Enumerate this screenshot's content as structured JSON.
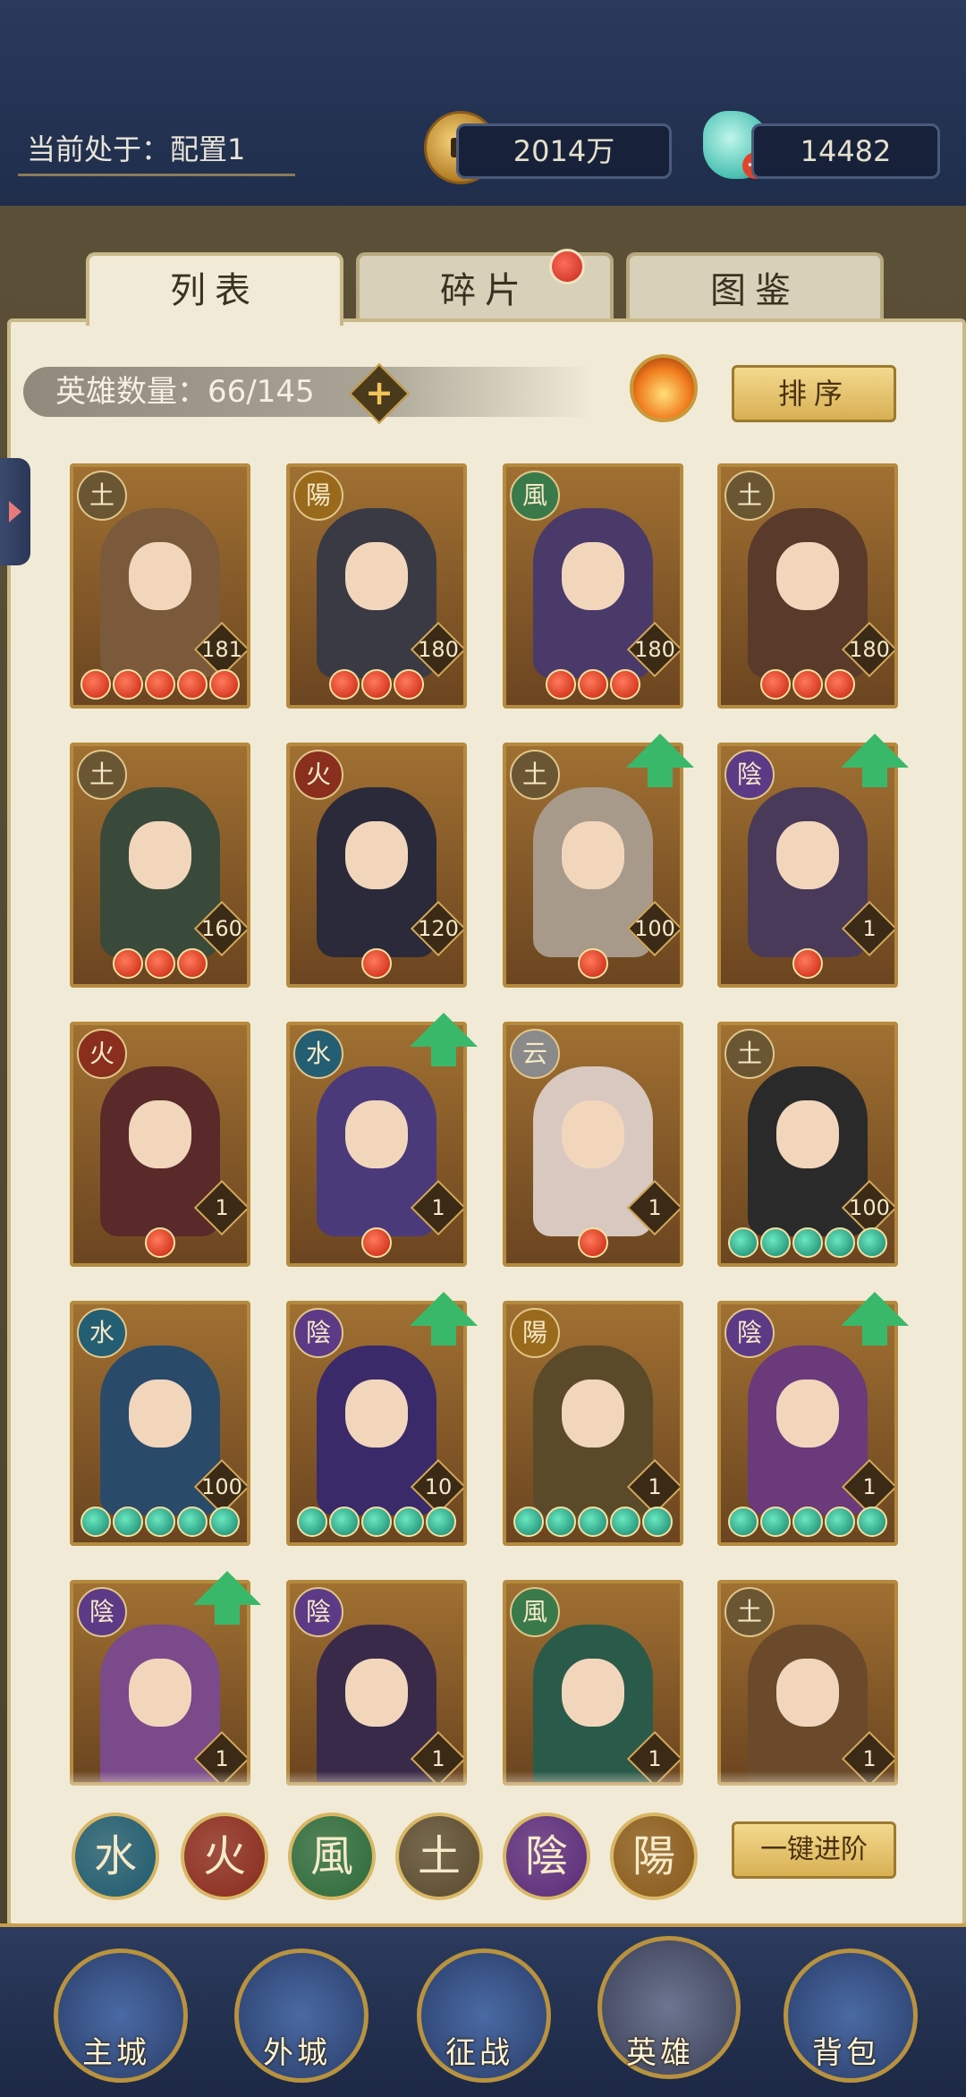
{
  "header": {
    "config_label": "当前处于：配置1",
    "gold_amount": "2014万",
    "gem_amount": "14482"
  },
  "tabs": [
    {
      "label": "列表",
      "active": true
    },
    {
      "label": "碎片",
      "active": false,
      "has_notification": true
    },
    {
      "label": "图鉴",
      "active": false
    }
  ],
  "hero_count": "英雄数量：66/145",
  "buttons": {
    "sort": "排序",
    "advance_all": "一键进阶",
    "add_plus": "+"
  },
  "heroes": [
    {
      "element": "土",
      "level": "181",
      "stars": 5,
      "star_color": "red",
      "upgradable": false
    },
    {
      "element": "陽",
      "level": "180",
      "stars": 3,
      "star_color": "red",
      "upgradable": false
    },
    {
      "element": "風",
      "level": "180",
      "stars": 3,
      "star_color": "red",
      "upgradable": false
    },
    {
      "element": "土",
      "level": "180",
      "stars": 3,
      "star_color": "red",
      "upgradable": false
    },
    {
      "element": "土",
      "level": "160",
      "stars": 3,
      "star_color": "red",
      "upgradable": false
    },
    {
      "element": "火",
      "level": "120",
      "stars": 1,
      "star_color": "red",
      "upgradable": false
    },
    {
      "element": "土",
      "level": "100",
      "stars": 1,
      "star_color": "red",
      "upgradable": true
    },
    {
      "element": "陰",
      "level": "1",
      "stars": 1,
      "star_color": "red",
      "upgradable": true
    },
    {
      "element": "火",
      "level": "1",
      "stars": 1,
      "star_color": "red",
      "upgradable": false
    },
    {
      "element": "水",
      "level": "1",
      "stars": 1,
      "star_color": "red",
      "upgradable": true
    },
    {
      "element": "云",
      "level": "1",
      "stars": 1,
      "star_color": "red",
      "upgradable": false
    },
    {
      "element": "土",
      "level": "100",
      "stars": 5,
      "star_color": "green",
      "upgradable": false
    },
    {
      "element": "水",
      "level": "100",
      "stars": 5,
      "star_color": "green",
      "upgradable": false
    },
    {
      "element": "陰",
      "level": "10",
      "stars": 5,
      "star_color": "green",
      "upgradable": true
    },
    {
      "element": "陽",
      "level": "1",
      "stars": 5,
      "star_color": "green",
      "upgradable": false
    },
    {
      "element": "陰",
      "level": "1",
      "stars": 5,
      "star_color": "green",
      "upgradable": true
    },
    {
      "element": "陰",
      "level": "1",
      "stars": 0,
      "star_color": "green",
      "upgradable": true
    },
    {
      "element": "陰",
      "level": "1",
      "stars": 0,
      "star_color": "green",
      "upgradable": false
    },
    {
      "element": "風",
      "level": "1",
      "stars": 0,
      "star_color": "green",
      "upgradable": false
    },
    {
      "element": "土",
      "level": "1",
      "stars": 0,
      "star_color": "green",
      "upgradable": false
    }
  ],
  "element_filters": [
    {
      "glyph": "水",
      "color": "#1e5a6e"
    },
    {
      "glyph": "火",
      "color": "#8a2a1c"
    },
    {
      "glyph": "風",
      "color": "#2c6a3a"
    },
    {
      "glyph": "土",
      "color": "#5a4a2e"
    },
    {
      "glyph": "陰",
      "color": "#5a2a7a"
    },
    {
      "glyph": "陽",
      "color": "#8a5a1a"
    }
  ],
  "bottom_nav": [
    {
      "label": "主城",
      "active": false
    },
    {
      "label": "外城",
      "active": false
    },
    {
      "label": "征战",
      "active": false
    },
    {
      "label": "英雄",
      "active": true
    },
    {
      "label": "背包",
      "active": false
    }
  ],
  "element_colors": {
    "土": "#6b5634",
    "陽": "#9a6a1c",
    "風": "#3a7a4a",
    "火": "#8a2e1e",
    "陰": "#5c3a86",
    "水": "#245e72",
    "云": "#8a8a8a"
  }
}
